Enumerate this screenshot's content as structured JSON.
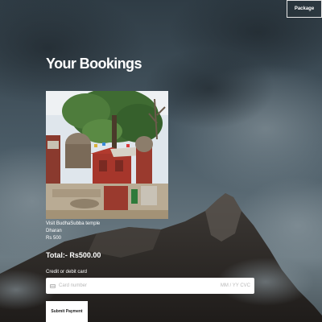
{
  "nav": {
    "package_label": "Package"
  },
  "page": {
    "title": "Your Bookings"
  },
  "booking": {
    "name": "Visit BudhaSubba temple",
    "location": "Dharan",
    "price": "Rs 500"
  },
  "summary": {
    "total": "Total:- Rs500.00"
  },
  "payment": {
    "card_label": "Credit or debit card",
    "card_number_placeholder": "Card number",
    "expiry_cvc_placeholder": "MM / YY  CVC",
    "submit_label": "Submit Payment"
  },
  "colors": {
    "text": "#ffffff",
    "placeholder": "#b8b8b8",
    "button_bg": "#ffffff"
  }
}
